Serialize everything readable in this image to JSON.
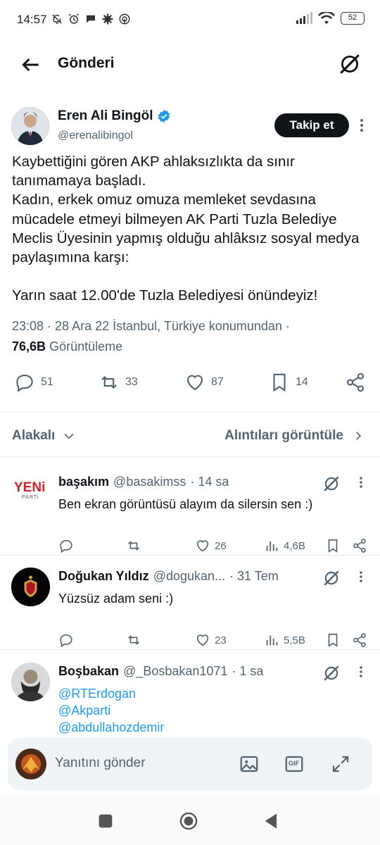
{
  "status_bar": {
    "time": "14:57",
    "battery": "52"
  },
  "header": {
    "title": "Gönderi"
  },
  "tweet": {
    "author_name": "Eren Ali Bingöl",
    "author_handle": "@erenalibingol",
    "follow_label": "Takip et",
    "text": "Kaybettiğini gören AKP ahlaksızlıkta da sınır tanımamaya başladı.\nKadın, erkek omuz omuza memleket sevdasına mücadele etmeyi bilmeyen AK Parti Tuzla Belediye Meclis Üyesinin yapmış olduğu ahlâksız sosyal medya paylaşımına karşı:\n\nYarın saat 12.00'de Tuzla Belediyesi önündeyiz!",
    "meta": "23:08 · 28 Ara 22 İstanbul, Türkiye konumundan ·",
    "views_count": "76,6B",
    "views_label": "Görüntüleme",
    "replies": "51",
    "retweets": "33",
    "likes": "87",
    "bookmarks": "14"
  },
  "filters": {
    "sort_label": "Alakalı",
    "quotes_label": "Alıntıları görüntüle"
  },
  "replies": [
    {
      "name": "başakım",
      "handle": "@basakimss",
      "time": "· 14 sa",
      "text": "Ben ekran görüntüsü alayım da silersin sen :)",
      "likes": "26",
      "views": "4,6B",
      "avatar_text": "YENi",
      "avatar_sub": "PARTi"
    },
    {
      "name": "Doğukan Yıldız",
      "handle": "@dogukan...",
      "time": "· 31 Tem",
      "text": "Yüzsüz adam seni :)",
      "likes": "23",
      "views": "5,5B"
    },
    {
      "name": "Boşbakan",
      "handle": "@_Bosbakan1071",
      "time": "· 1 sa",
      "mentions": [
        "@RTErdogan",
        "@Akparti",
        "@abdullahozdemir"
      ]
    }
  ],
  "reply_bar": {
    "placeholder": "Yanıtını gönder",
    "gif_label": "GIF"
  },
  "colors": {
    "accent": "#1d9bf0",
    "text": "#0f1419",
    "muted": "#536471",
    "yeni_red": "#d8212a"
  }
}
